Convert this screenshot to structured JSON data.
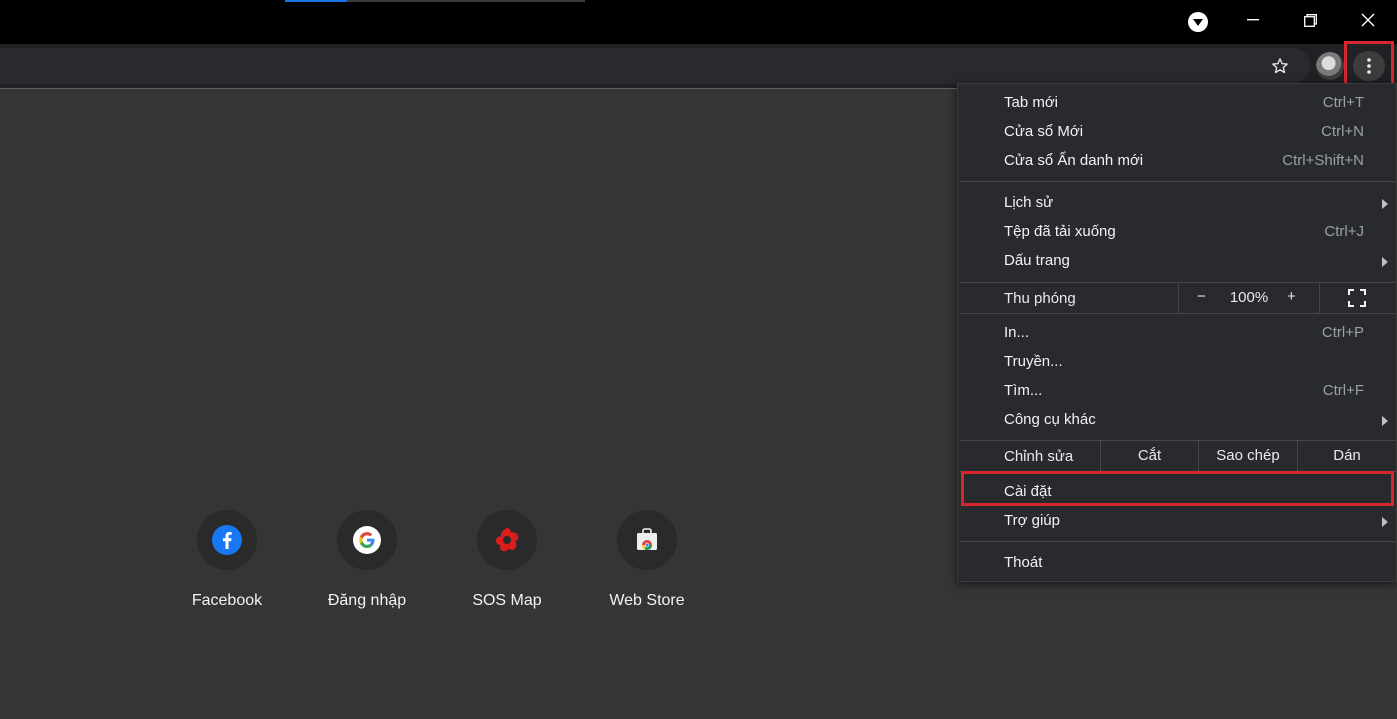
{
  "colors": {
    "page_background": "#353535",
    "menu_background": "#292a2d",
    "highlight_border": "#d7262d",
    "tab_accent": "#1a73e8"
  },
  "titlebar": {
    "icons": [
      "tab-search-icon",
      "minimize-icon",
      "restore-icon",
      "close-icon"
    ]
  },
  "toolbar": {
    "icons": [
      "bookmark-star-icon",
      "profile-avatar",
      "more-vert-icon"
    ]
  },
  "shortcuts": [
    {
      "label": "Facebook",
      "icon": "facebook-icon"
    },
    {
      "label": "Đăng nhập",
      "icon": "google-icon"
    },
    {
      "label": "SOS Map",
      "icon": "sos-map-icon"
    },
    {
      "label": "Web Store",
      "icon": "web-store-icon"
    }
  ],
  "menu": {
    "group1": [
      {
        "label": "Tab mới",
        "shortcut": "Ctrl+T"
      },
      {
        "label": "Cửa sổ Mới",
        "shortcut": "Ctrl+N"
      },
      {
        "label": "Cửa sổ Ẩn danh mới",
        "shortcut": "Ctrl+Shift+N"
      }
    ],
    "group2": [
      {
        "label": "Lịch sử",
        "shortcut": ""
      },
      {
        "label": "Tệp đã tải xuống",
        "shortcut": "Ctrl+J"
      },
      {
        "label": "Dấu trang",
        "shortcut": ""
      }
    ],
    "zoom": {
      "label": "Thu phóng",
      "minus": "−",
      "value": "100%",
      "plus": "+"
    },
    "group3": [
      {
        "label": "In...",
        "shortcut": "Ctrl+P"
      },
      {
        "label": "Truyền...",
        "shortcut": ""
      },
      {
        "label": "Tìm...",
        "shortcut": "Ctrl+F"
      },
      {
        "label": "Công cụ khác",
        "shortcut": ""
      }
    ],
    "edit": {
      "label": "Chỉnh sửa",
      "cut": "Cắt",
      "copy": "Sao chép",
      "paste": "Dán"
    },
    "settings": {
      "label": "Cài đặt"
    },
    "help": {
      "label": "Trợ giúp"
    },
    "exit": {
      "label": "Thoát"
    }
  }
}
